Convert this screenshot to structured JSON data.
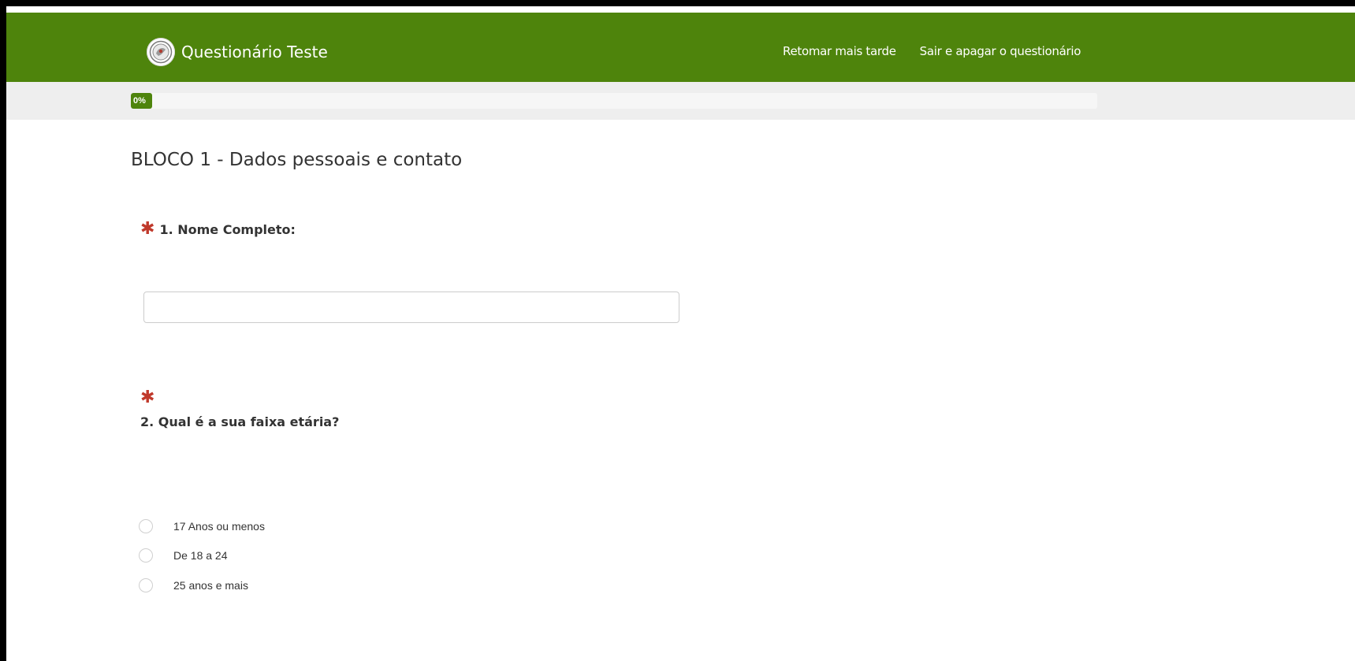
{
  "header": {
    "title": "Questionário Teste",
    "logo_icon": "institution-seal-icon",
    "links": {
      "resume_later": "Retomar mais tarde",
      "exit_and_clear": "Sair e apagar o questionário"
    },
    "background_color": "#4e840c"
  },
  "progress": {
    "percent": 0,
    "label": "0%"
  },
  "section": {
    "title": "BLOCO 1 - Dados pessoais e contato"
  },
  "questions": [
    {
      "required_marker": "✱",
      "label": "1. Nome Completo:",
      "input_value": ""
    },
    {
      "required_marker": "✱",
      "label": "2. Qual é a sua faixa etária?",
      "options": [
        "17 Anos ou menos",
        "De 18 a 24",
        "25 anos e mais"
      ],
      "selected": null
    }
  ],
  "colors": {
    "required_asterisk": "#c0392b",
    "accent": "#4e840c"
  }
}
